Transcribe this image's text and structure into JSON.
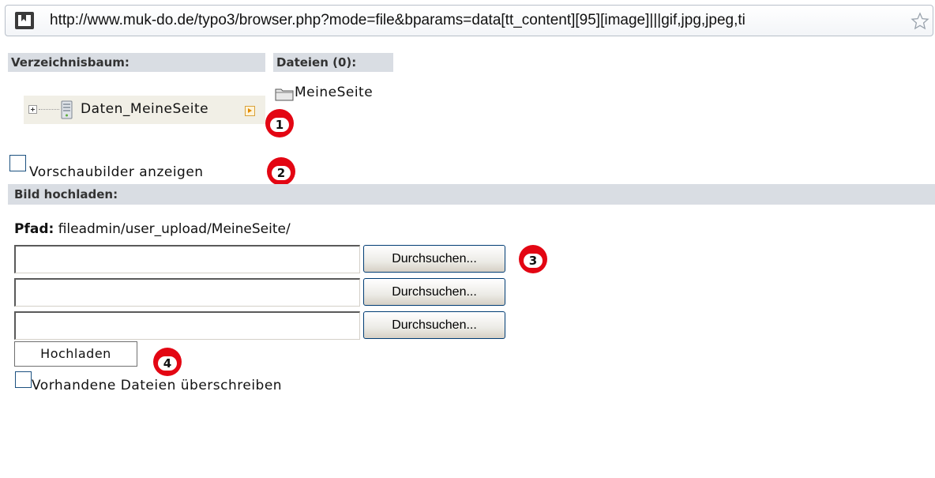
{
  "browser": {
    "url": "http://www.muk-do.de/typo3/browser.php?mode=file&bparams=data[tt_content][95][image]|||gif,jpg,jpeg,ti",
    "site_icon": "typo3-logo-icon",
    "bookmark_icon": "star-icon"
  },
  "headers": {
    "tree": "Verzeichnisbaum:",
    "files": "Dateien (0):"
  },
  "tree": {
    "root_label": "Daten_MeineSeite"
  },
  "files": {
    "folder_label": "MeineSeite"
  },
  "thumbnails": {
    "label": "Vorschaubilder anzeigen",
    "checked": false
  },
  "upload": {
    "section_title": "Bild hochladen:",
    "path_label": "Pfad:",
    "path_value": "fileadmin/user_upload/MeineSeite/",
    "file_inputs": [
      {
        "value": "",
        "browse_label": "Durchsuchen..."
      },
      {
        "value": "",
        "browse_label": "Durchsuchen..."
      },
      {
        "value": "",
        "browse_label": "Durchsuchen..."
      }
    ],
    "submit_label": "Hochladen",
    "overwrite_label": "Vorhandene Dateien überschreiben",
    "overwrite_checked": false
  },
  "markers": [
    "1",
    "2",
    "3",
    "4"
  ],
  "colors": {
    "marker_red": "#e30613",
    "header_bg": "#d9dde3",
    "button_border": "#003c74"
  }
}
